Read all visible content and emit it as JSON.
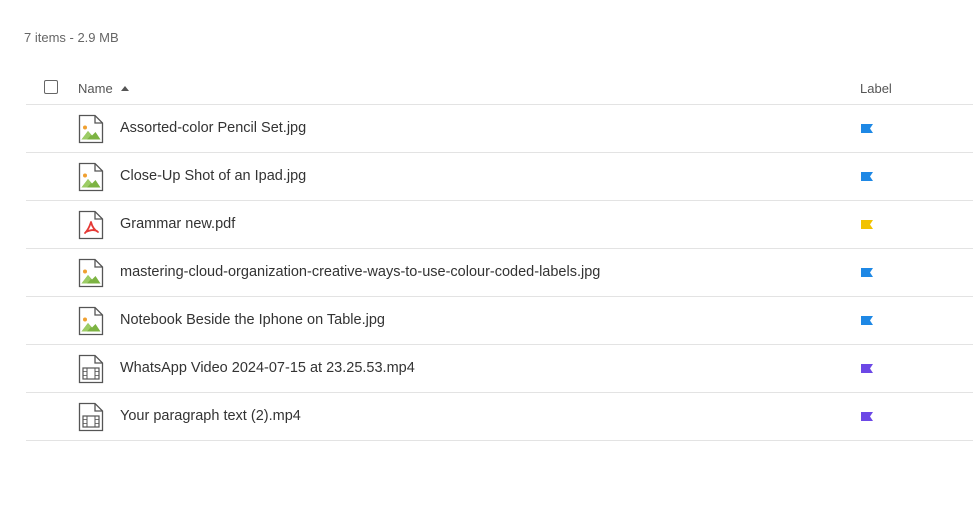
{
  "summary": "7 items - 2.9 MB",
  "columns": {
    "name": "Name",
    "label": "Label"
  },
  "colors": {
    "blue": "#1e88e5",
    "yellow": "#f2c200",
    "purple": "#6c48e6"
  },
  "files": [
    {
      "name": "Assorted-color Pencil Set.jpg",
      "type": "image-file-icon",
      "label_color": "#1e88e5"
    },
    {
      "name": "Close-Up Shot of an Ipad.jpg",
      "type": "image-file-icon",
      "label_color": "#1e88e5"
    },
    {
      "name": "Grammar new.pdf",
      "type": "pdf-file-icon",
      "label_color": "#f2c200"
    },
    {
      "name": "mastering-cloud-organization-creative-ways-to-use-colour-coded-labels.jpg",
      "type": "image-file-icon",
      "label_color": "#1e88e5"
    },
    {
      "name": "Notebook Beside the Iphone on Table.jpg",
      "type": "image-file-icon",
      "label_color": "#1e88e5"
    },
    {
      "name": "WhatsApp Video 2024-07-15 at 23.25.53.mp4",
      "type": "video-file-icon",
      "label_color": "#6c48e6"
    },
    {
      "name": "Your paragraph text (2).mp4",
      "type": "video-file-icon",
      "label_color": "#6c48e6"
    }
  ]
}
